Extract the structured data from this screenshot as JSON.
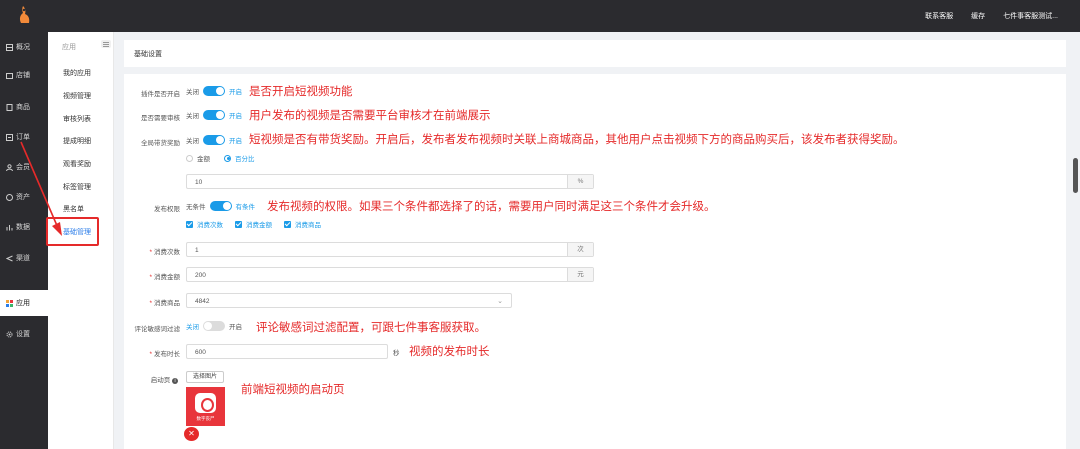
{
  "topbar": {
    "links": [
      "联系客服",
      "缓存",
      "七件事客服测试..."
    ]
  },
  "sidebar": {
    "items": [
      {
        "label": "概况",
        "icon": "dashboard-icon"
      },
      {
        "label": "店铺",
        "icon": "shop-icon"
      },
      {
        "label": "商品",
        "icon": "goods-icon"
      },
      {
        "label": "订单",
        "icon": "order-icon"
      },
      {
        "label": "会员",
        "icon": "member-icon"
      },
      {
        "label": "资产",
        "icon": "asset-icon"
      },
      {
        "label": "数据",
        "icon": "data-icon"
      },
      {
        "label": "渠道",
        "icon": "channel-icon"
      },
      {
        "label": "应用",
        "icon": "apps-icon"
      },
      {
        "label": "设置",
        "icon": "settings-icon"
      }
    ],
    "active": "应用"
  },
  "submenu": {
    "header": "应用",
    "items": [
      "我的应用",
      "视频管理",
      "审核列表",
      "提成明细",
      "观看奖励",
      "标签管理",
      "黑名单",
      "基础管理"
    ],
    "active": "基础管理"
  },
  "page": {
    "title": "基础设置"
  },
  "form": {
    "plugin_enabled": {
      "label": "插件是否开启",
      "off": "关闭",
      "on": "开启",
      "value": true,
      "note": "是否开启短视频功能"
    },
    "need_review": {
      "label": "是否需要审核",
      "off": "关闭",
      "on": "开启",
      "value": true,
      "note": "用户发布的视频是否需要平台审核才在前端展示"
    },
    "reward": {
      "label": "全局带货奖励",
      "off": "关闭",
      "on": "开启",
      "value": true,
      "note": "短视频是否有带货奖励。开启后，发布者发布视频时关联上商城商品，其他用户点击视频下方的商品购买后，该发布者获得奖励。",
      "radio_options": [
        "金额",
        "百分比"
      ],
      "radio_selected": "百分比",
      "amount": "10",
      "amount_unit": "%"
    },
    "publish_permission": {
      "label": "发布权限",
      "off": "无条件",
      "on": "有条件",
      "value": true,
      "note": "发布视频的权限。如果三个条件都选择了的话，需要用户同时满足这三个条件才会升级。",
      "checks": [
        "消费次数",
        "消费金额",
        "消费商品"
      ]
    },
    "consume_count": {
      "label": "消费次数",
      "value": "1",
      "unit": "次"
    },
    "consume_amount": {
      "label": "消费金额",
      "value": "200",
      "unit": "元"
    },
    "consume_goods": {
      "label": "消费商品",
      "value": "4842"
    },
    "comment_filter": {
      "label": "评论敏感词过滤",
      "off": "关闭",
      "on": "开启",
      "value": false,
      "note": "评论敏感词过滤配置，可跟七件事客服获取。"
    },
    "publish_duration": {
      "label": "发布时长",
      "value": "600",
      "unit": "秒",
      "note": "视频的发布时长"
    },
    "splash": {
      "label": "启动页",
      "button": "选择图片",
      "preview_text": "数字丧尸",
      "note": "前端短视频的启动页"
    }
  },
  "colors": {
    "accent": "#1a9be8",
    "annotation": "#e52a2a",
    "dark": "#2b2b2f"
  }
}
